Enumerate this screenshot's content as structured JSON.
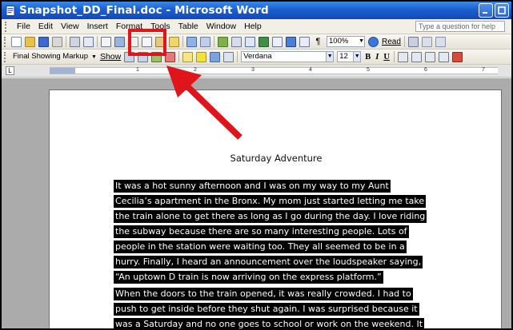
{
  "window": {
    "title": "Snapshot_DD_Final.doc - Microsoft Word",
    "icons": {
      "app": "word-doc-icon",
      "minimize": "minimize-icon",
      "maximize": "maximize-icon"
    }
  },
  "menu": {
    "items": [
      {
        "label": "File"
      },
      {
        "label": "Edit"
      },
      {
        "label": "View"
      },
      {
        "label": "Insert"
      },
      {
        "label": "Format"
      },
      {
        "label": "Tools"
      },
      {
        "label": "Table"
      },
      {
        "label": "Window"
      },
      {
        "label": "Help"
      }
    ],
    "help_placeholder": "Type a question for help"
  },
  "toolbar_standard": {
    "zoom": "100%",
    "read_label": "Read"
  },
  "toolbar_formatting": {
    "markup_mode": "Final Showing Markup",
    "show_label": "Show",
    "font_name": "Verdana",
    "font_size": "12",
    "bold": "B",
    "italic": "I",
    "underline": "U"
  },
  "ruler": {
    "marks": [
      "1",
      "2",
      "3",
      "4",
      "5",
      "6",
      "7"
    ]
  },
  "document": {
    "title": "Saturday Adventure",
    "paragraph1": [
      "It was a hot sunny afternoon and I was on my way to my Aunt",
      "Cecilia’s apartment in the Bronx. My mom just started letting me take",
      "the train alone to get there as long as I go during the day. I love riding",
      "the subway because there are so many interesting people. Lots of",
      "people in the station were waiting too. They all seemed to be in a",
      "hurry. Finally, I heard an announcement over the loudspeaker saying,",
      "“An uptown D train is now arriving on the express platform.”"
    ],
    "paragraph2": [
      "When the doors to the train opened, it was really crowded. I had to",
      "push to get inside before they shut again. I was surprised because it",
      "was a Saturday and no one goes to school or work on the weekend. It"
    ]
  },
  "annotation": {
    "highlight_color": "#e0141b",
    "target": "copy-button"
  }
}
